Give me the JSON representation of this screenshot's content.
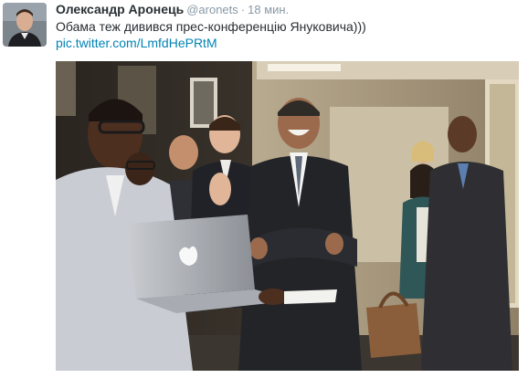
{
  "tweet": {
    "author_name": "Олександр Аронець",
    "username": "@aronets",
    "separator": "·",
    "time": "18 мин.",
    "text": "Обама теж дивився прес-конференцію Януковича)))",
    "link": "pic.twitter.com/LmfdHePRtM"
  },
  "icons": {
    "avatar": "user-avatar-photo",
    "photo": "attached-photo",
    "laptop_logo": "apple-logo-icon"
  }
}
